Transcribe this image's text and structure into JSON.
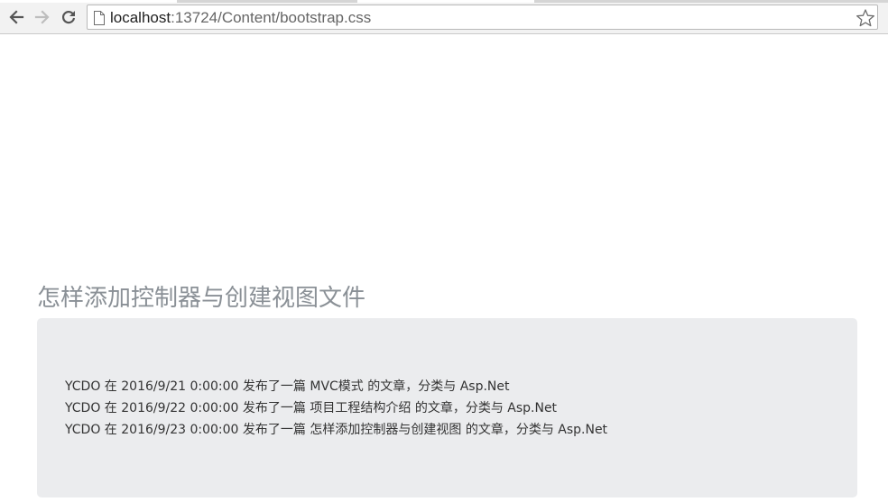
{
  "browser": {
    "url_host": "localhost",
    "url_rest": ":13724/Content/bootstrap.css",
    "back_icon": "arrow-left-icon",
    "forward_icon": "arrow-right-icon",
    "reload_icon": "reload-icon",
    "page_icon": "document-icon",
    "bookmark_icon": "star-outline-icon"
  },
  "page": {
    "title": "怎样添加控制器与创建视图文件",
    "posts": [
      {
        "text": "YCDO 在 2016/9/21 0:00:00 发布了一篇 MVC模式 的文章，分类与 Asp.Net"
      },
      {
        "text": "YCDO 在 2016/9/22 0:00:00 发布了一篇 项目工程结构介绍 的文章，分类与 Asp.Net"
      },
      {
        "text": "YCDO 在 2016/9/23 0:00:00 发布了一篇 怎样添加控制器与创建视图 的文章，分类与 Asp.Net"
      }
    ]
  },
  "colors": {
    "toolbar": "#f2f2f2",
    "jumbotron": "#ebecee",
    "title": "#8a9096",
    "text": "#333333"
  }
}
